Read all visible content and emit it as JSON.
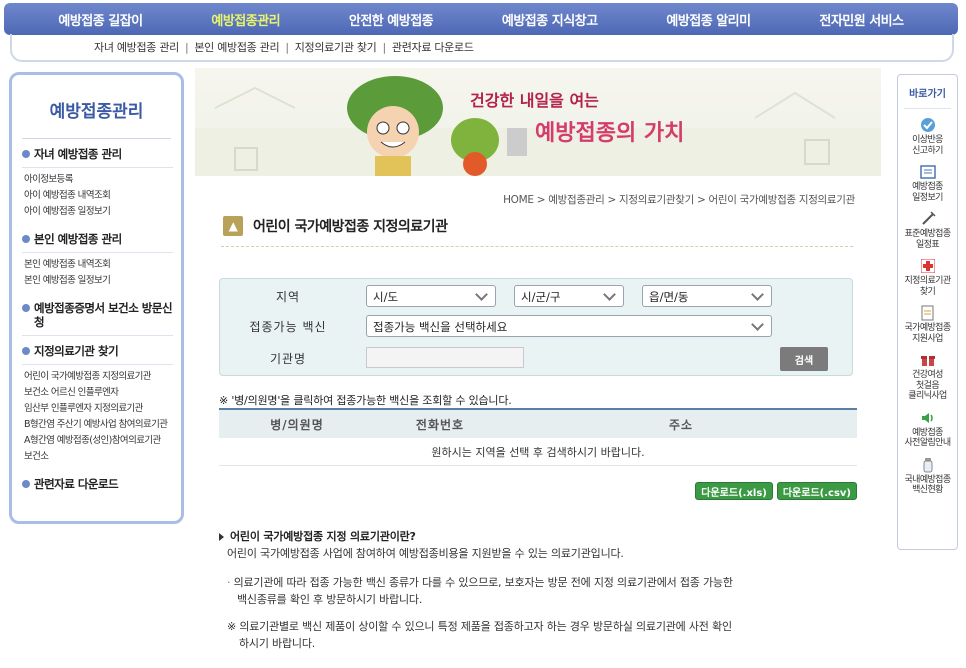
{
  "topnav": {
    "items": [
      "예방접종 길잡이",
      "예방접종관리",
      "안전한 예방접종",
      "예방접종 지식창고",
      "예방접종 알리미",
      "전자민원 서비스"
    ]
  },
  "subnav": {
    "items": [
      "자녀 예방접종 관리",
      "본인 예방접종 관리",
      "지정의료기관 찾기",
      "관련자료 다운로드"
    ]
  },
  "sidebar": {
    "title": "예방접종관리",
    "sec1": "자녀 예방접종 관리",
    "sec1_items": [
      "아이정보등록",
      "아이 예방접종 내역조회",
      "아이 예방접종 일정보기"
    ],
    "sec2": "본인 예방접종 관리",
    "sec2_items": [
      "본인 예방접종 내역조회",
      "본인 예방접종 일정보기"
    ],
    "sec3": "예방접종증명서 보건소 방문신청",
    "sec4": "지정의료기관 찾기",
    "sec4_items": [
      "어린이 국가예방접종 지정의료기관",
      "보건소 어르신 인플루엔자",
      "임산부 인플루엔자 지정의료기관",
      "B형간염 주산기 예방사업 참여의료기관",
      "A형간염 예방접종(성인)참여의료기관",
      "보건소"
    ],
    "sec5": "관련자료 다운로드"
  },
  "banner": {
    "slogan_part1": "건강한 내일을 여는",
    "slogan_part2": "예방접종의 가치"
  },
  "content": {
    "breadcrumb": [
      "HOME",
      "예방접종관리",
      "지정의료기관찾기",
      "어린이 국가예방접종 지정의료기관"
    ],
    "title": "어린이 국가예방접종 지정의료기관",
    "search": {
      "region_label": "지역",
      "sido": "시/도",
      "sigungu": "시/군/구",
      "eupmyeondong": "읍/면/동",
      "vaccine_label": "접종가능 백신",
      "vaccine_value": "접종가능 백신을 선택하세요",
      "org_label": "기관명",
      "org_value": "",
      "search_button": "검색"
    },
    "notice": "※ '병/의원명'을 클릭하여 접종가능한 백신을 조회할 수 있습니다.",
    "table": {
      "headers": [
        "병/의원명",
        "전화번호",
        "주소"
      ],
      "empty_message": "원하시는 지역을 선택 후 검색하시기 바랍니다."
    },
    "download_xls": "다운로드(.xls)",
    "download_csv": "다운로드(.csv)",
    "info": {
      "heading": "어린이 국가예방접종 지정 의료기관이란?",
      "desc": "어린이 국가예방접종 사업에 참여하여 예방접종비용을 지원받을 수 있는 의료기관입니다.",
      "bullet1_line1": "의료기관에 따라 접종 가능한 백신 종류가 다를 수 있으므로, 보호자는 방문 전에 지정 의료기관에서 접종 가능한",
      "bullet1_line2": "백신종류를 확인 후 방문하시기 바랍니다.",
      "note_line1": "※ 의료기관별로 백신 제품이 상이할 수 있으니 특정 제품을 접종하고자 하는 경우 방문하실 의료기관에 사전 확인",
      "note_line2": "하시기 바랍니다."
    }
  },
  "quick": {
    "title": "바로가기",
    "items": [
      {
        "l1": "이상반응",
        "l2": "신고하기",
        "icon": "check-circle-icon"
      },
      {
        "l1": "예방접종",
        "l2": "일정보기",
        "icon": "calendar-list-icon"
      },
      {
        "l1": "표준예방접종",
        "l2": "일정표",
        "icon": "syringe-icon"
      },
      {
        "l1": "지정의료기관",
        "l2": "찾기",
        "icon": "hospital-cross-icon"
      },
      {
        "l1": "국가예방접종",
        "l2": "지원사업",
        "icon": "document-icon"
      },
      {
        "l1": "건강여성",
        "l2": "첫걸음",
        "l3": "클리닉사업",
        "icon": "gift-icon"
      },
      {
        "l1": "예방접종",
        "l2": "사전알림안내",
        "icon": "speaker-icon"
      },
      {
        "l1": "국내예방접종",
        "l2": "백신현황",
        "icon": "vial-icon"
      }
    ]
  }
}
